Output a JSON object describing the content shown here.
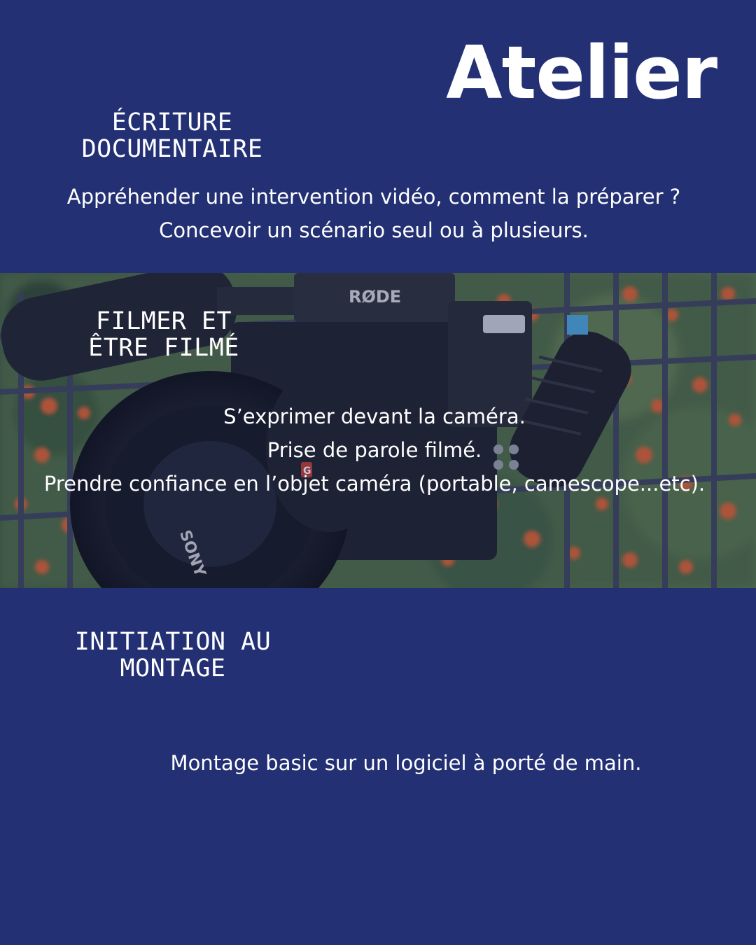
{
  "title": "Atelier",
  "sections": [
    {
      "heading_lines": [
        "ÉCRITURE",
        "DOCUMENTAIRE"
      ],
      "text_lines": [
        "Appréhender une intervention vidéo, comment la préparer ?",
        "Concevoir un scénario seul ou à plusieurs."
      ]
    },
    {
      "heading_lines": [
        "FILMER ET",
        "ÊTRE FILMÉ"
      ],
      "text_lines": [
        "S’exprimer devant la caméra.",
        "Prise de parole filmé.",
        "Prendre confiance en l’objet caméra (portable, camescope...etc)."
      ]
    },
    {
      "heading_lines": [
        "INITIATION AU",
        "MONTAGE"
      ],
      "text_lines": [
        "Montage basic sur un logiciel à porté de main."
      ]
    }
  ],
  "photo": {
    "brand_microphone": "RØDE",
    "brand_camera": "SONY",
    "lens_badge": "G"
  },
  "colors": {
    "background": "#233074",
    "text": "#ffffff",
    "flower_orange": "#e0602a",
    "foliage_green": "#4a6a3a"
  }
}
